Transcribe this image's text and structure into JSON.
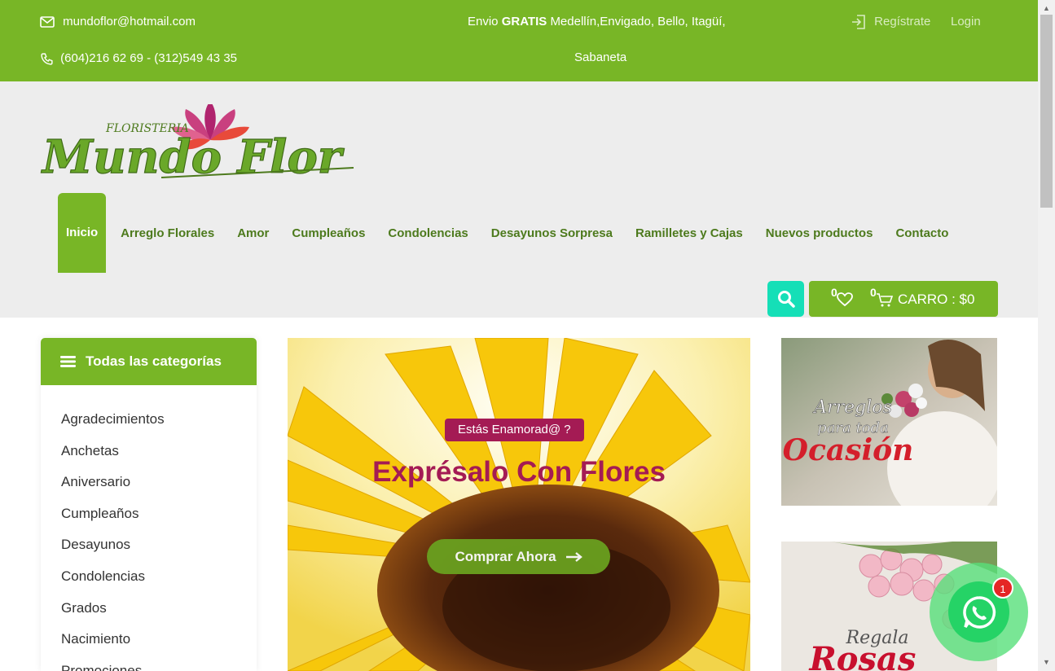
{
  "topbar": {
    "email": "mundoflor@hotmail.com",
    "phones": "(604)216 62 69 - (312)549 43 35",
    "shipping_prefix": "Envio",
    "shipping_bold": "GRATIS",
    "shipping_line1": "Medellín,Envigado, Bello, Itagüí,",
    "shipping_line2": "Sabaneta",
    "register": "Regístrate",
    "login": "Login"
  },
  "logo": {
    "top_text": "FLORISTERIA",
    "main_text": "Mundo Flor"
  },
  "nav": {
    "items": [
      "Inicio",
      "Arreglo Florales",
      "Amor",
      "Cumpleaños",
      "Condolencias",
      "Desayunos Sorpresa",
      "Ramilletes y Cajas",
      "Nuevos productos",
      "Contacto"
    ]
  },
  "cart": {
    "wishlist_count": "0",
    "cart_count": "0",
    "label": "CARRO : $0"
  },
  "sidebar": {
    "title": "Todas las categorías",
    "categories": [
      "Agradecimientos",
      "Anchetas",
      "Aniversario",
      "Cumpleaños",
      "Desayunos",
      "Condolencias",
      "Grados",
      "Nacimiento",
      "Promociones"
    ]
  },
  "hero": {
    "tag": "Estás Enamorad@ ?",
    "title": "Exprésalo Con Flores",
    "button": "Comprar Ahora"
  },
  "banners": {
    "b1_line1": "Arreglos",
    "b1_line2": "para toda",
    "b1_line3": "Ocasión",
    "b2_line1": "Regala",
    "b2_line2": "Rosas"
  },
  "whatsapp": {
    "badge": "1"
  },
  "colors": {
    "green": "#78b626",
    "dark_green": "#4d7a1d",
    "magenta": "#a41b54",
    "teal": "#15dfb7"
  }
}
